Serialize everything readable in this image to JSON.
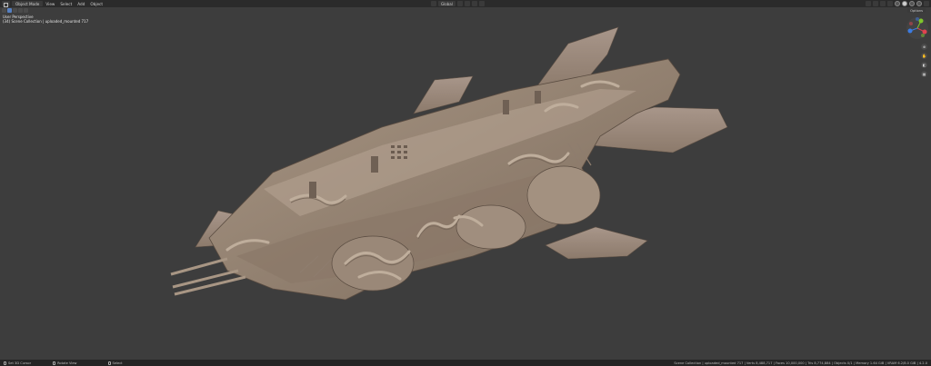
{
  "header": {
    "mode": "Object Mode",
    "menus": [
      "View",
      "Select",
      "Add",
      "Object"
    ],
    "transform_orientation": "Global",
    "options_label": "Options"
  },
  "viewport": {
    "perspective": "User Perspective",
    "collection_line": "(34) Scene Collection | uploaded_mounted 717"
  },
  "gizmo": {
    "x_color": "#e0434f",
    "y_color": "#7fc62b",
    "z_color": "#3c7ce2"
  },
  "status": {
    "left_items": [
      "Set 3D Cursor",
      "Rotate View",
      "Select"
    ],
    "right_text": "Scene Collection | uploaded_mounted 717 | Verts 8,488,717 | Faces 10,000,000 | Tris 8,774,884 | Objects 0/1 | Memory 1.64 GiB | VRAM 6.2/8.0 GiB | 4.2.0"
  },
  "model": {
    "base_color": "#9a8878",
    "shade_color": "#6e5f52"
  }
}
